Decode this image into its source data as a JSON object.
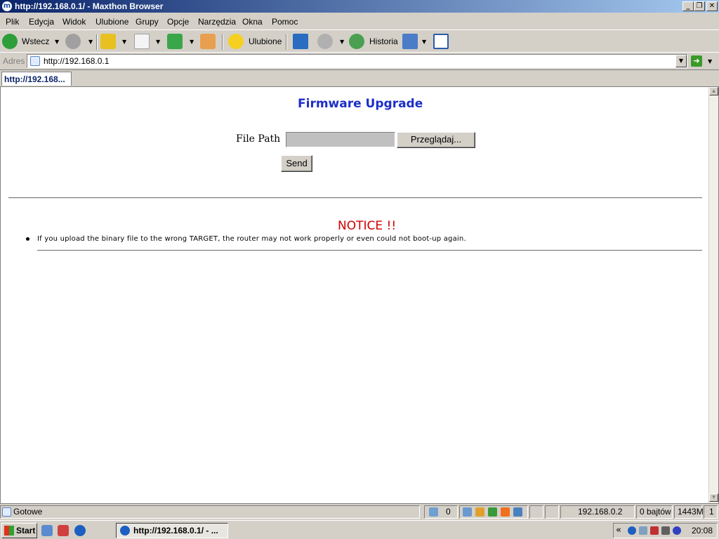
{
  "window": {
    "title": "http://192.168.0.1/ - Maxthon Browser",
    "app_icon_glyph": "m",
    "controls": {
      "minimize": "_",
      "maximize": "❐",
      "close": "✕"
    }
  },
  "menu": [
    "Plik",
    "Edycja",
    "Widok",
    "Ulubione",
    "Grupy",
    "Opcje",
    "Narzędzia",
    "Okna",
    "Pomoc"
  ],
  "toolbar": {
    "back_label": "Wstecz",
    "favorites_label": "Ulubione",
    "history_label": "Historia"
  },
  "address": {
    "label": "Adres",
    "url": "http://192.168.0.1"
  },
  "tabs": [
    {
      "label": "http://192.168..."
    }
  ],
  "page": {
    "title": "Firmware Upgrade",
    "file_path_label": "File Path",
    "file_path_value": "",
    "browse_label": "Przeglądaj...",
    "send_label": "Send",
    "notice_title": "NOTICE !!",
    "notice_items": [
      "If you upload the binary file to the wrong TARGET, the router may not work properly or even could not boot-up again."
    ],
    "title_color": "#1c2ec8",
    "notice_color": "#d00000"
  },
  "status": {
    "text": "Gotowe",
    "popup_count": "0",
    "ip": "192.168.0.2",
    "bytes": "0 bajtów",
    "memory": "1443M",
    "page_number": "1"
  },
  "taskbar": {
    "start_label": "Start",
    "task_label": "http://192.168.0.1/ - ...",
    "tray_chevron": "«",
    "clock": "20:08"
  }
}
